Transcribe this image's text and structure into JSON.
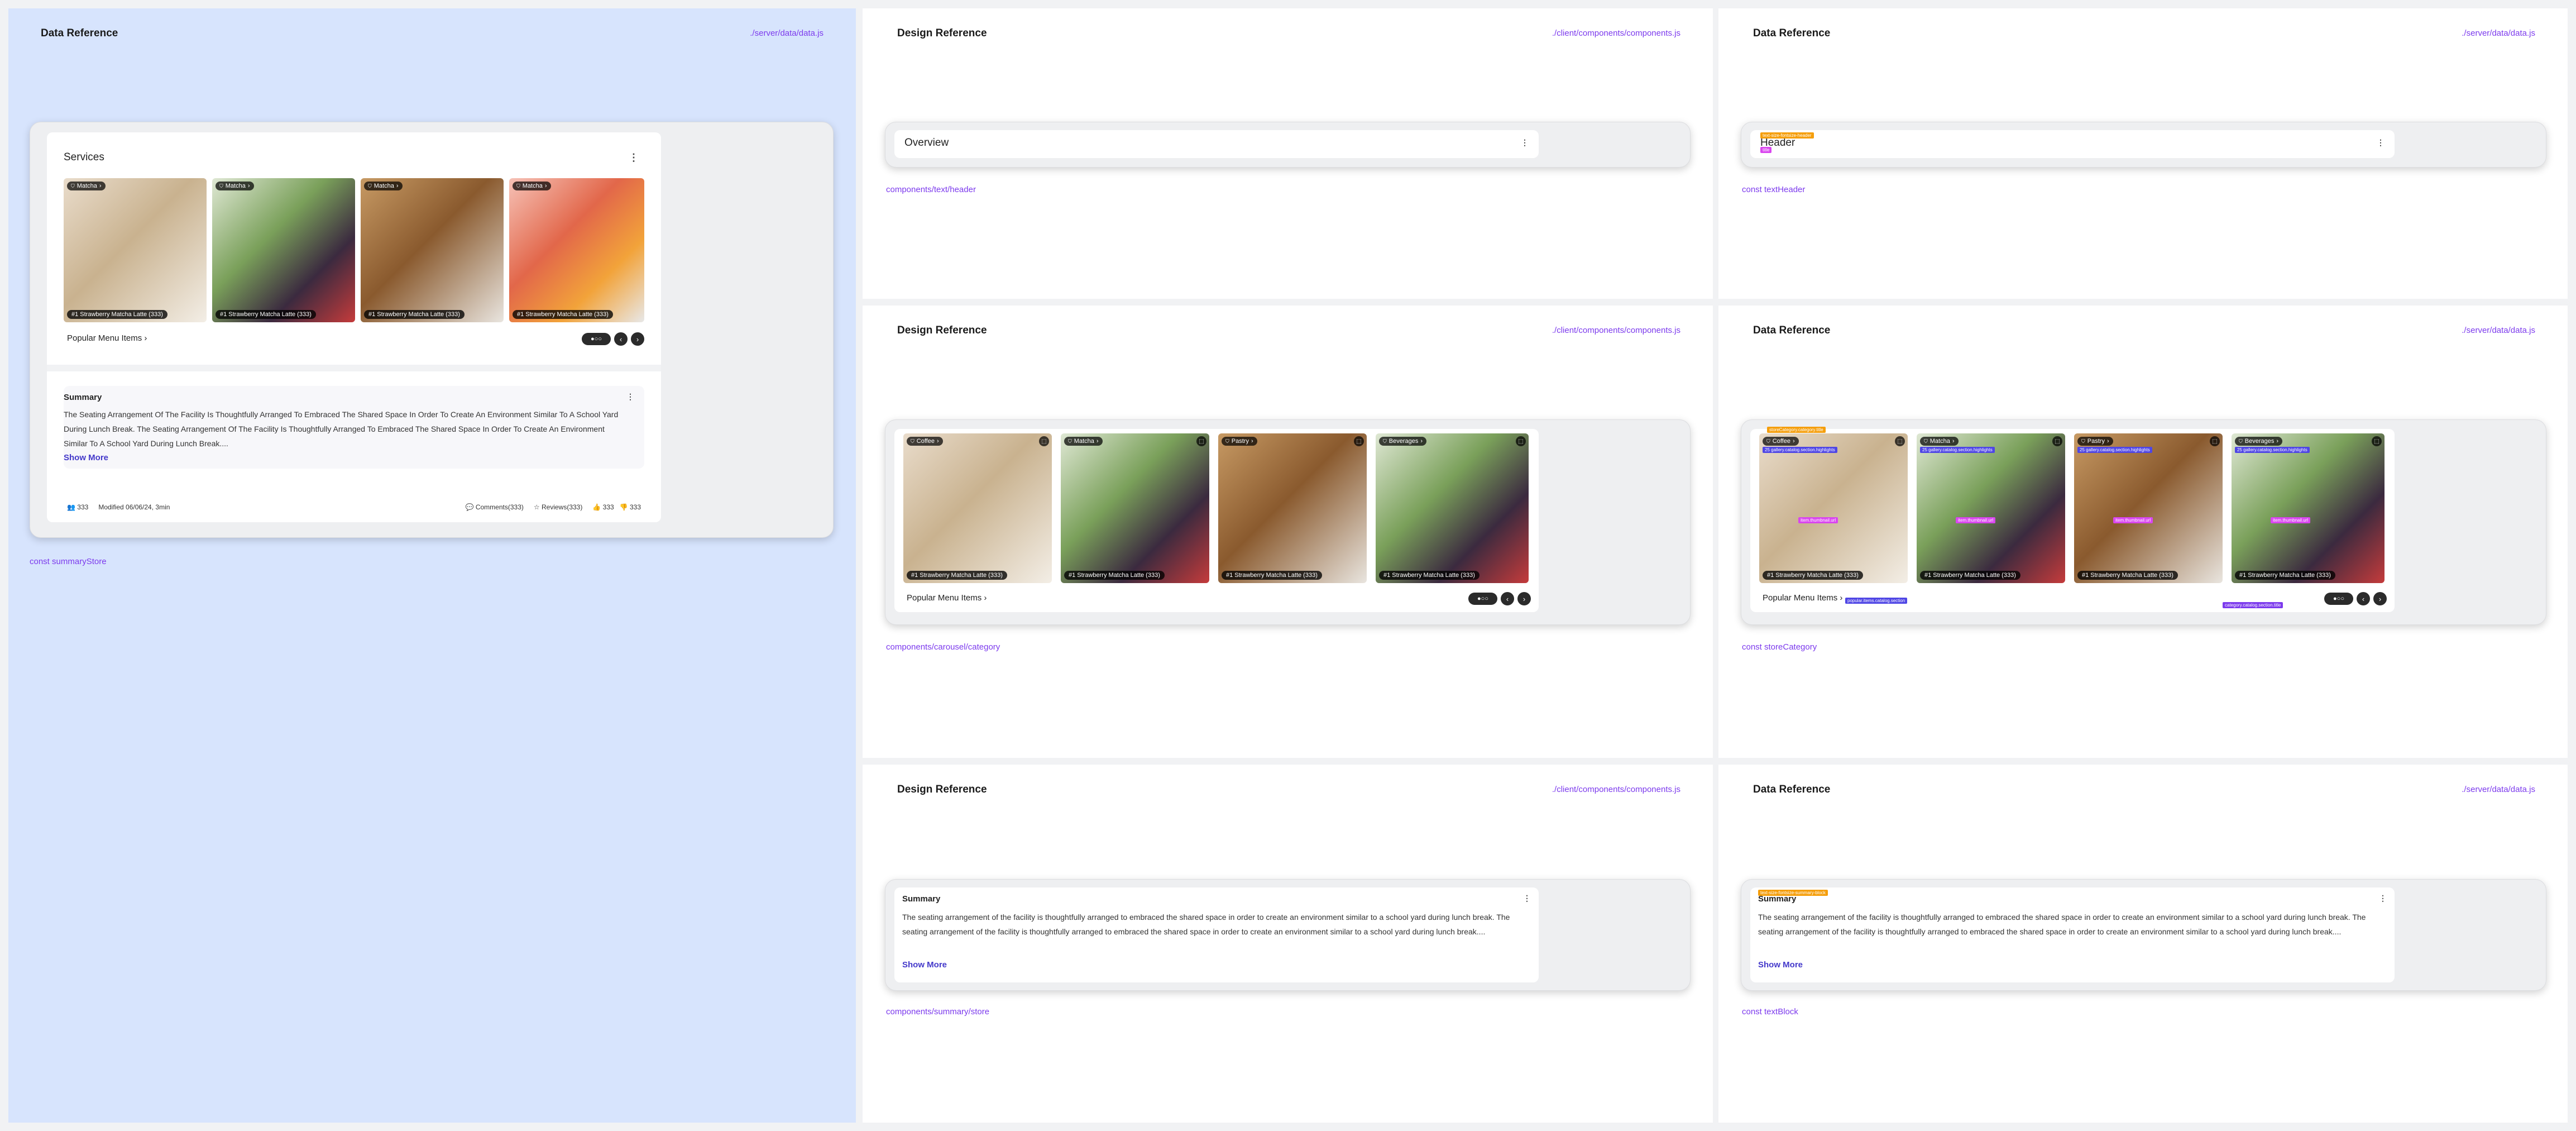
{
  "panels": {
    "left": {
      "title": "Data Reference",
      "path": "./server/data/data.js",
      "label": "const summaryStore"
    },
    "mid_top": {
      "title": "Design Reference",
      "path": "./client/components/components.js",
      "label": "components/text/header"
    },
    "right_top": {
      "title": "Data Reference",
      "path": "./server/data/data.js",
      "label": "const textHeader"
    },
    "mid_mid": {
      "title": "Design Reference",
      "path": "./client/components/components.js",
      "label": "components/carousel/category"
    },
    "right_mid": {
      "title": "Data Reference",
      "path": "./server/data/data.js",
      "label": "const storeCategory"
    },
    "mid_bot": {
      "title": "Design Reference",
      "path": "./client/components/components.js",
      "label": "components/summary/store"
    },
    "right_bot": {
      "title": "Data Reference",
      "path": "./server/data/data.js",
      "label": "const textBlock"
    }
  },
  "services_card": {
    "title": "Services",
    "menu_icon": "more-vertical-icon",
    "items": [
      {
        "tag": "Matcha",
        "caption": "#1  Strawberry Matcha Latte (333)"
      },
      {
        "tag": "Matcha",
        "caption": "#1  Strawberry Matcha Latte (333)"
      },
      {
        "tag": "Matcha",
        "caption": "#1  Strawberry Matcha Latte (333)"
      },
      {
        "tag": "Matcha",
        "caption": "#1  Strawberry Matcha Latte (333)"
      }
    ],
    "popular_label": "Popular Menu Items",
    "pager_dots": "●○○",
    "summary_title": "Summary",
    "summary_text": "The Seating Arrangement Of The Facility Is Thoughtfully Arranged To Embraced The Shared Space In Order To Create An Environment Similar To A School Yard During Lunch Break. The Seating Arrangement Of The Facility Is Thoughtfully Arranged To Embraced The Shared Space In Order To Create An Environment Similar To A School Yard During Lunch Break....",
    "show_more": "Show More",
    "footer": {
      "people": "333",
      "modified": "Modified 06/06/24, 3min",
      "comments": "Comments(333)",
      "reviews": "Reviews(333)",
      "likes": "333",
      "dislikes": "333"
    }
  },
  "header_design": {
    "title": "Overview"
  },
  "header_data": {
    "title": "Header",
    "overlay_a": "text-size-fontsize-header",
    "overlay_b": "title"
  },
  "carousel_design": {
    "items": [
      {
        "tag": "Coffee",
        "caption": "#1  Strawberry Matcha Latte (333)"
      },
      {
        "tag": "Matcha",
        "caption": "#1  Strawberry Matcha Latte (333)"
      },
      {
        "tag": "Pastry",
        "caption": "#1  Strawberry Matcha Latte (333)"
      },
      {
        "tag": "Beverages",
        "caption": "#1  Strawberry Matcha Latte (333)"
      }
    ],
    "popular_label": "Popular Menu Items",
    "pager_dots": "●○○"
  },
  "carousel_data": {
    "items": [
      {
        "tag": "Coffee",
        "caption": "#1  Strawberry Matcha Latte (333)"
      },
      {
        "tag": "Matcha",
        "caption": "#1  Strawberry Matcha Latte (333)"
      },
      {
        "tag": "Pastry",
        "caption": "#1  Strawberry Matcha Latte (333)"
      },
      {
        "tag": "Beverages",
        "caption": "#1  Strawberry Matcha Latte (333)"
      }
    ],
    "popular_label": "Popular Menu Items",
    "pager_dots": "●○○",
    "overlay_top": "storeCategory.category.title",
    "overlay_small": "25 gallery.catalog.section.highlights",
    "overlay_mid": "item.thumbnail.url",
    "overlay_bottom": "popular.items.catalog.section",
    "overlay_caption": "category.catalog.section.title"
  },
  "summary_design": {
    "title": "Summary",
    "text": "The seating arrangement of the facility is thoughtfully arranged to embraced the shared space in order to create an environment similar to a school yard during lunch break. The seating arrangement of the facility is thoughtfully arranged to embraced the shared space in order to create an environment similar to a school yard during lunch break....",
    "show_more": "Show More"
  },
  "summary_data": {
    "title": "Summary",
    "text": "The seating arrangement of the facility is thoughtfully arranged to embraced the shared space in order to create an environment similar to a school yard during lunch break. The seating arrangement of the facility is thoughtfully arranged to embraced the shared space in order to create an environment similar to a school yard during lunch break....",
    "show_more": "Show More",
    "overlay": "text-size-fontsize-summary-block"
  },
  "colors": {
    "accent": "#7c3aed",
    "link": "#4338ca",
    "left_panel_bg": "#d7e4fd"
  }
}
